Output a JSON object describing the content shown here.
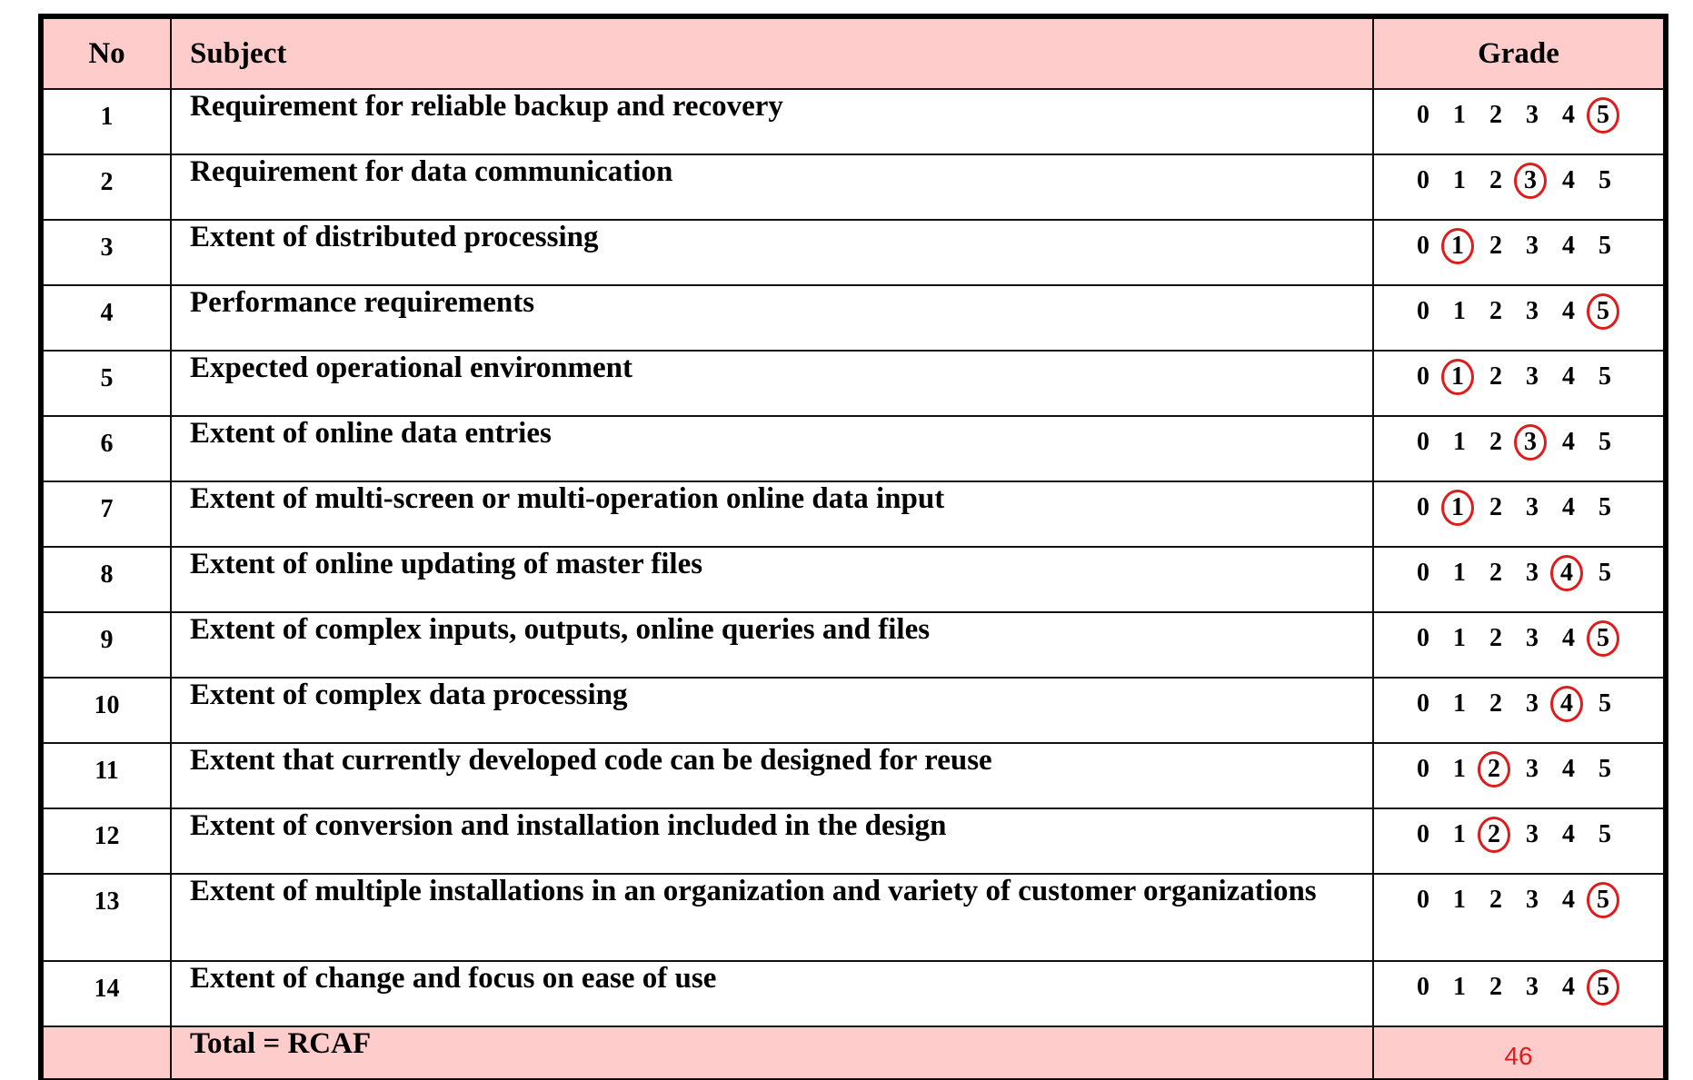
{
  "header": {
    "no": "No",
    "subject": "Subject",
    "grade": "Grade"
  },
  "grade_scale": [
    "0",
    "1",
    "2",
    "3",
    "4",
    "5"
  ],
  "rows": [
    {
      "no": "1",
      "subject": "Requirement for reliable backup and recovery",
      "grade": 5
    },
    {
      "no": "2",
      "subject": "Requirement for data communication",
      "grade": 3
    },
    {
      "no": "3",
      "subject": "Extent of distributed processing",
      "grade": 1
    },
    {
      "no": "4",
      "subject": "Performance requirements",
      "grade": 5
    },
    {
      "no": "5",
      "subject": "Expected operational environment",
      "grade": 1
    },
    {
      "no": "6",
      "subject": "Extent of online data entries",
      "grade": 3
    },
    {
      "no": "7",
      "subject": "Extent of multi-screen or multi-operation online data input",
      "grade": 1
    },
    {
      "no": "8",
      "subject": "Extent of online updating of master files",
      "grade": 4
    },
    {
      "no": "9",
      "subject": "Extent of complex inputs, outputs, online queries and files",
      "grade": 5
    },
    {
      "no": "10",
      "subject": "Extent of complex data processing",
      "grade": 4
    },
    {
      "no": "11",
      "subject": "Extent that currently developed code can be designed for reuse",
      "grade": 2
    },
    {
      "no": "12",
      "subject": "Extent of conversion and installation included in the design",
      "grade": 2
    },
    {
      "no": "13",
      "subject": "Extent of multiple installations in an organization and variety of customer organizations",
      "grade": 5
    },
    {
      "no": "14",
      "subject": "Extent of change and focus on ease of use",
      "grade": 5
    }
  ],
  "total": {
    "label": "Total = RCAF"
  },
  "page_number": "46",
  "colors": {
    "header_bg": "#ffcccc",
    "circle": "#e01b1b",
    "page_number": "#e01b1b"
  }
}
